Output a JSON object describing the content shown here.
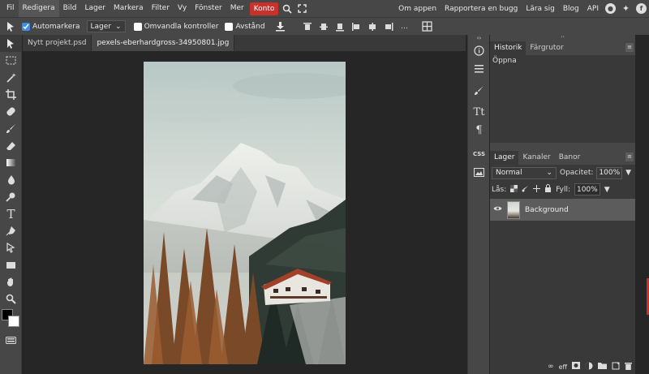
{
  "menu": {
    "items": [
      "Fil",
      "Redigera",
      "Bild",
      "Lager",
      "Markera",
      "Filter",
      "Vy",
      "Fönster",
      "Mer"
    ],
    "active_index": 1,
    "konto": "Konto",
    "right_links": [
      "Om appen",
      "Rapportera en bugg",
      "Lära sig",
      "Blog",
      "API"
    ]
  },
  "options": {
    "automarkera": "Automarkera",
    "automarkera_checked": true,
    "layer_select": "Lager",
    "omvandla": "Omvandla kontroller",
    "avstand": "Avstånd"
  },
  "tabs": [
    "Nytt projekt.psd",
    "pexels-eberhardgross-34950801.jpg"
  ],
  "history": {
    "tabs": [
      "Historik",
      "Färgrutor"
    ],
    "items": [
      "Öppna"
    ]
  },
  "layers": {
    "tabs": [
      "Lager",
      "Kanaler",
      "Banor"
    ],
    "blend_mode": "Normal",
    "opacity_label": "Opacitet:",
    "opacity_value": "100%",
    "lock_label": "Lås:",
    "fill_label": "Fyll:",
    "fill_value": "100%",
    "layer_name": "Background"
  },
  "strip_labels": {
    "css": "CSS"
  },
  "colors": {
    "accent": "#3d8ee6",
    "konto": "#c8322d",
    "panel": "#474747",
    "canvas": "#262626"
  }
}
